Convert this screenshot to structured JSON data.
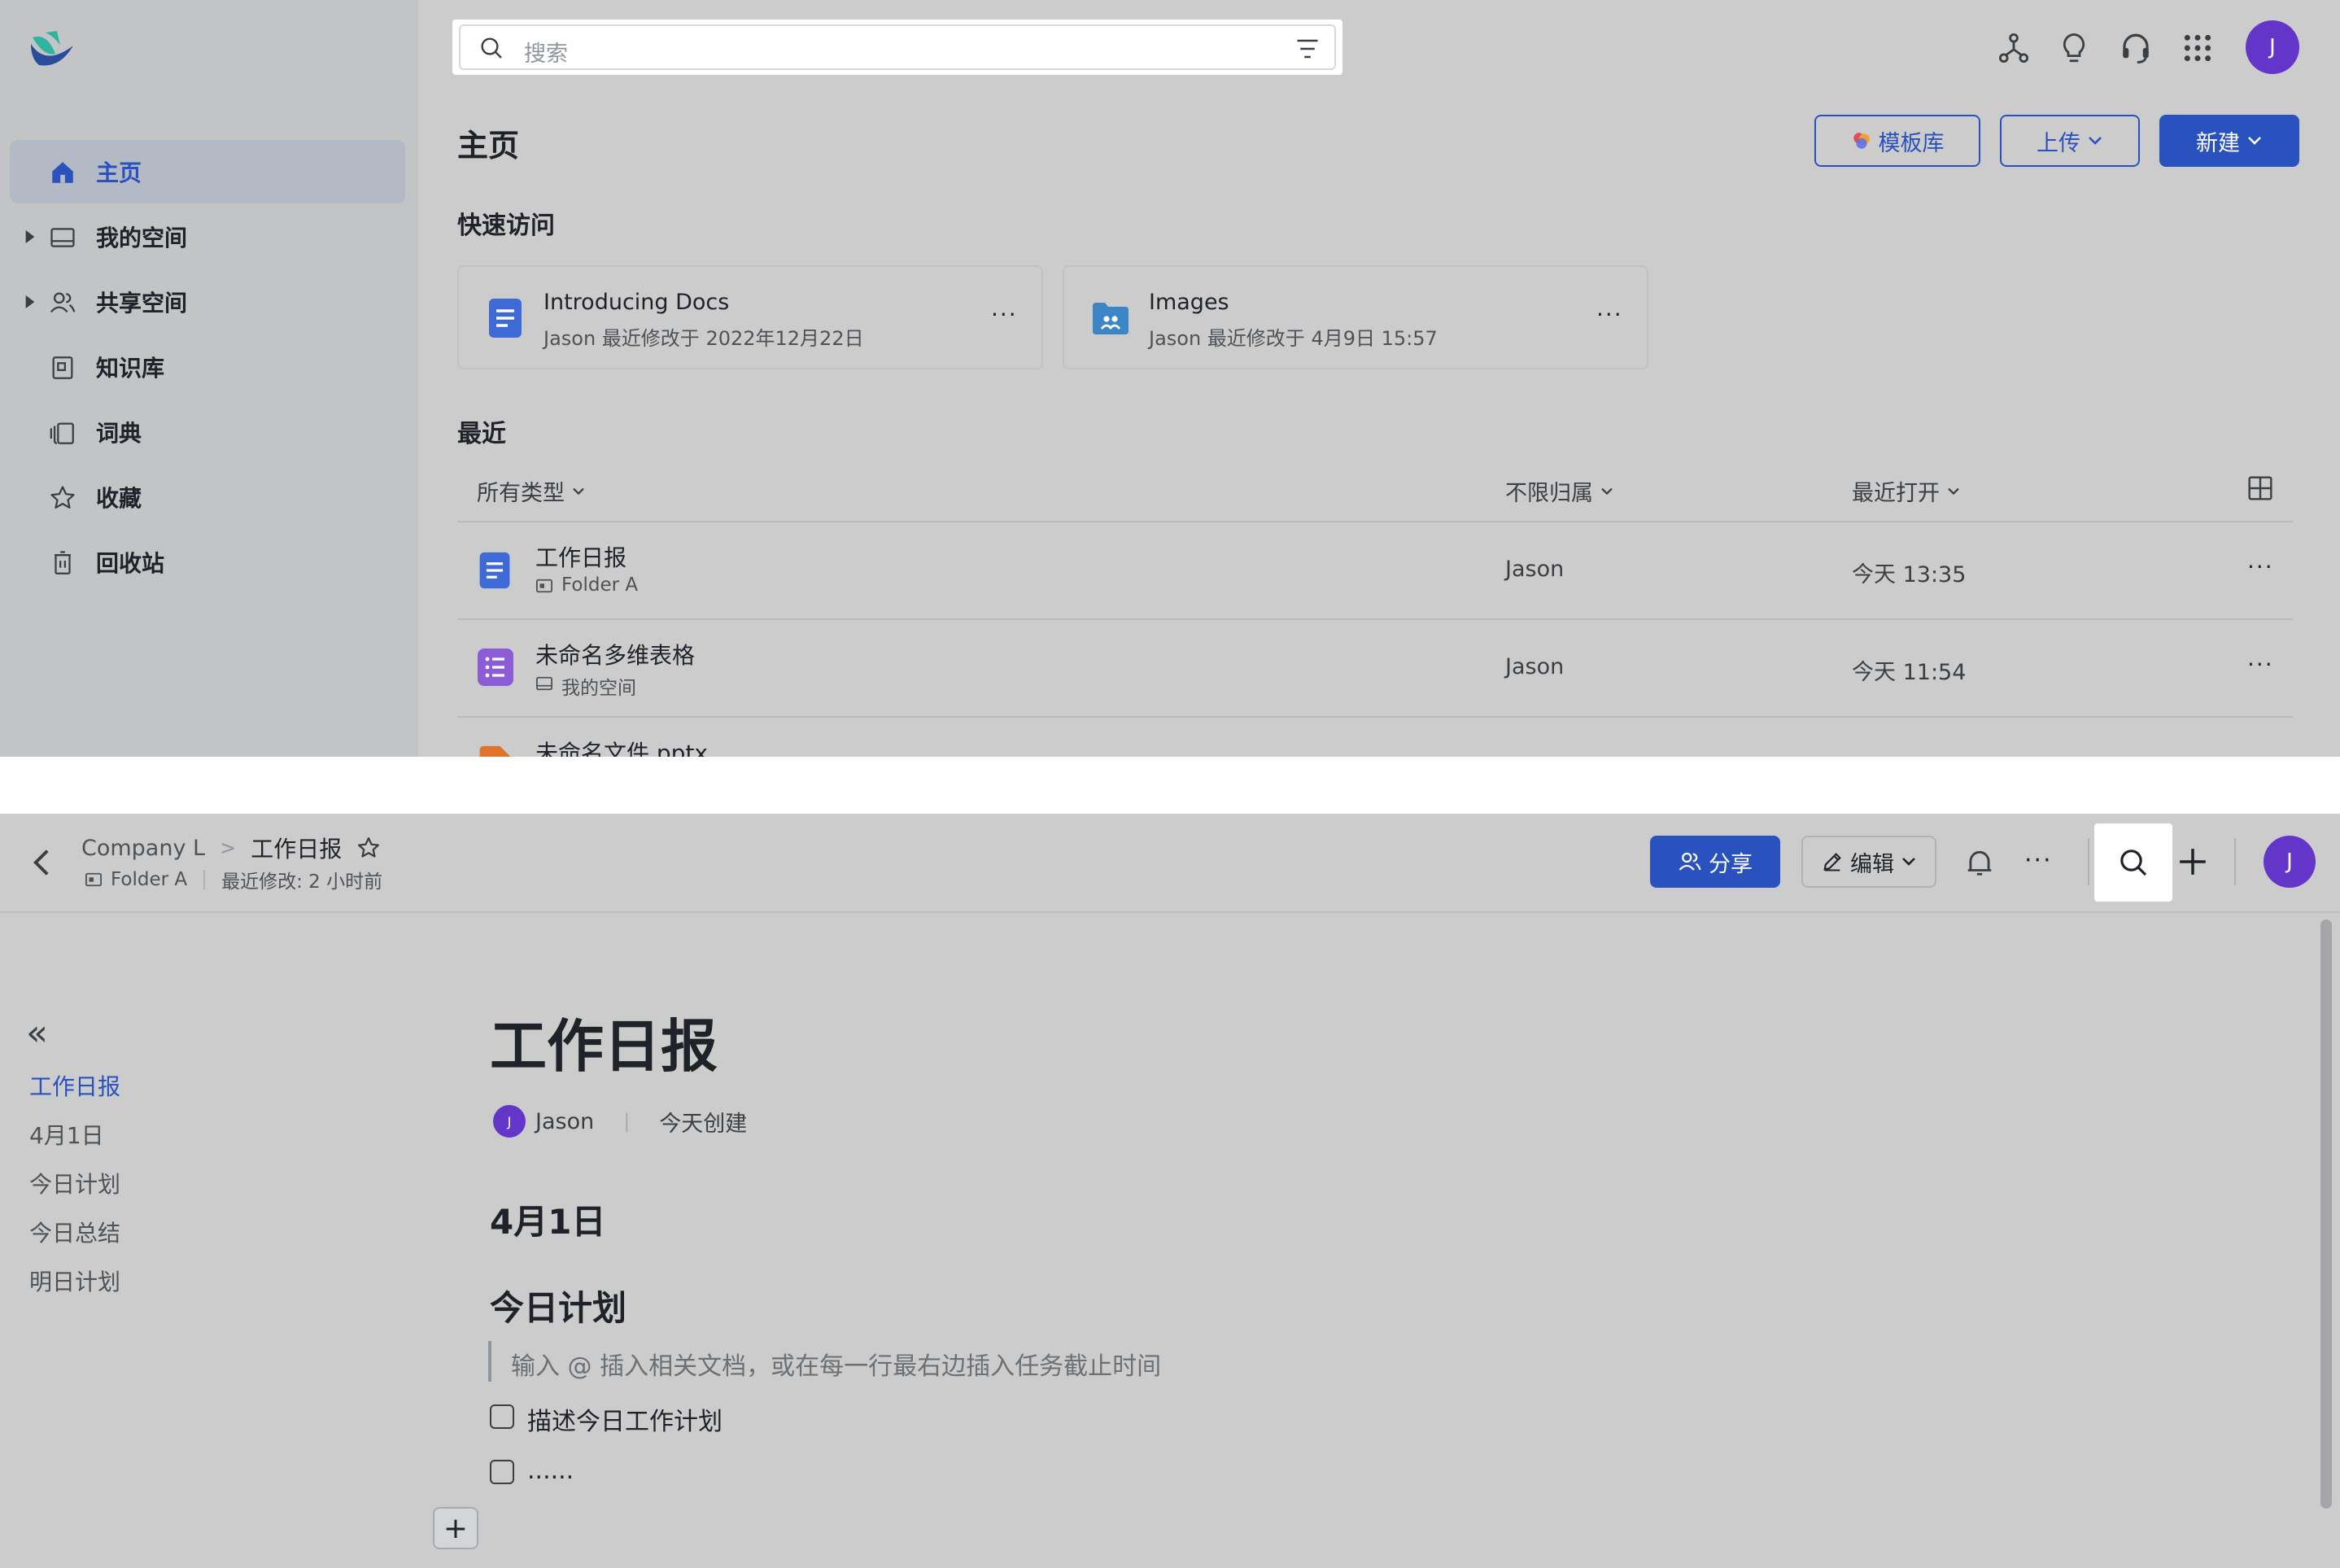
{
  "home": {
    "search": {
      "placeholder": "搜索"
    },
    "nav": [
      {
        "label": "主页"
      },
      {
        "label": "我的空间"
      },
      {
        "label": "共享空间"
      },
      {
        "label": "知识库"
      },
      {
        "label": "词典"
      },
      {
        "label": "收藏"
      },
      {
        "label": "回收站"
      }
    ],
    "avatar": "J",
    "page_title": "主页",
    "buttons": {
      "templates": "模板库",
      "upload": "上传",
      "new": "新建"
    },
    "quick_access_title": "快速访问",
    "quick_access": [
      {
        "title": "Introducing Docs",
        "subtitle": "Jason 最近修改于 2022年12月22日",
        "more": "···"
      },
      {
        "title": "Images",
        "subtitle": "Jason 最近修改于 4月9日 15:57",
        "more": "···"
      }
    ],
    "recent_title": "最近",
    "filters": {
      "type": "所有类型",
      "owner": "不限归属",
      "sort": "最近打开"
    },
    "recent": [
      {
        "title": "工作日报",
        "location": "Folder A",
        "owner": "Jason",
        "time": "今天 13:35",
        "more": "···"
      },
      {
        "title": "未命名多维表格",
        "location": "我的空间",
        "owner": "Jason",
        "time": "今天 11:54",
        "more": "···"
      },
      {
        "title": "未命名文件.pptx"
      }
    ],
    "colors": {
      "accent": "#2a52be",
      "doc": "#3d6ad6",
      "base": "#8b5cd6",
      "folder": "#3d86c6",
      "ppt": "#e0742c"
    }
  },
  "doc": {
    "breadcrumb": {
      "space": "Company L",
      "separator": ">",
      "title": "工作日报"
    },
    "meta": {
      "folder": "Folder A",
      "modified": "最近修改: 2 小时前"
    },
    "buttons": {
      "share": "分享",
      "edit": "编辑",
      "more": "···"
    },
    "avatar": "J",
    "toc_collapse": "«",
    "toc": [
      {
        "label": "工作日报"
      },
      {
        "label": "4月1日"
      },
      {
        "label": "今日计划"
      },
      {
        "label": "今日总结"
      },
      {
        "label": "明日计划"
      }
    ],
    "title": "工作日报",
    "author": {
      "avatar": "J",
      "name": "Jason",
      "divider": "|",
      "created": "今天创建"
    },
    "heading1": "4月1日",
    "heading2": "今日计划",
    "quote": "输入 @ 插入相关文档，或在每一行最右边插入任务截止时间",
    "tasks": [
      {
        "text": "描述今日工作计划"
      },
      {
        "text": "......"
      }
    ],
    "add_block": "+"
  }
}
